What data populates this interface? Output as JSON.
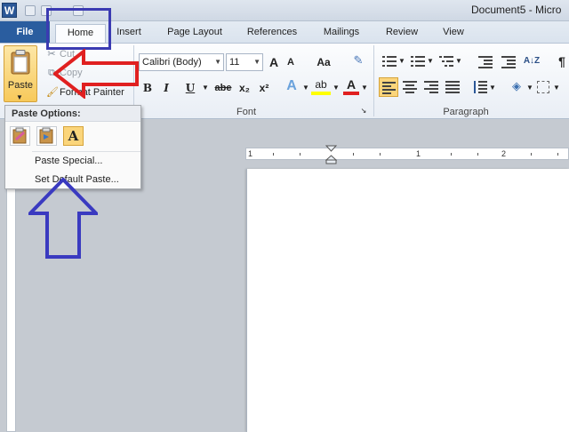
{
  "window": {
    "title": "Document5 - Micro",
    "logo_letter": "W"
  },
  "tabs": [
    {
      "label": "File"
    },
    {
      "label": "Home"
    },
    {
      "label": "Insert"
    },
    {
      "label": "Page Layout"
    },
    {
      "label": "References"
    },
    {
      "label": "Mailings"
    },
    {
      "label": "Review"
    },
    {
      "label": "View"
    }
  ],
  "clipboard": {
    "paste_label": "Paste",
    "cut_label": "Cut",
    "copy_label": "Copy",
    "format_painter_label": "Format Painter"
  },
  "font_group": {
    "label": "Font",
    "font_name": "Calibri (Body)",
    "font_size": "11",
    "grow_label": "A",
    "shrink_label": "A",
    "change_case_label": "Aa",
    "bold_label": "B",
    "italic_label": "I",
    "underline_label": "U",
    "strikethrough_label": "abe",
    "subscript_label": "x₂",
    "superscript_label": "x²",
    "text_effects_label": "A",
    "highlight_label": "ab",
    "font_color_label": "A"
  },
  "paragraph_group": {
    "label": "Paragraph",
    "sort_label": "A↓Z",
    "pilcrow": "¶"
  },
  "paste_menu": {
    "header": "Paste Options:",
    "text_only_label": "A",
    "paste_special_label": "Paste Special...",
    "set_default_label": "Set Default Paste..."
  },
  "ruler": {
    "labels": [
      "1",
      "1",
      "2"
    ]
  },
  "colors": {
    "file_tab": "#2a5d9f",
    "highlight_box": "#3b3bb2",
    "red_arrow": "#e02020",
    "blue_arrow": "#3a3ac0",
    "paste_button": "#f7c95a"
  }
}
